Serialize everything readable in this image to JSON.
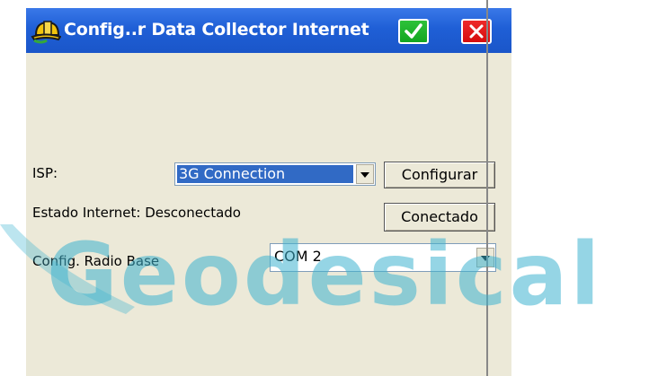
{
  "window": {
    "title": "Config..r Data Collector Internet",
    "ok_icon": "check-icon",
    "close_icon": "close-icon",
    "app_icon": "hardhat-icon"
  },
  "form": {
    "isp_label": "ISP:",
    "isp_value": "3G Connection",
    "configure_button": "Configurar",
    "status_text": "Estado Internet: Desconectado",
    "connect_button": "Conectado",
    "radio_label": "Config. Radio Base",
    "radio_value": "COM 2"
  },
  "watermark": {
    "text": "Geodesical",
    "color": "#3fb4d0"
  },
  "colors": {
    "titlebar": "#1f5fd6",
    "background": "#ECE9D8",
    "selection": "#316AC5",
    "ok": "#13a520",
    "close": "#d60d0d"
  }
}
